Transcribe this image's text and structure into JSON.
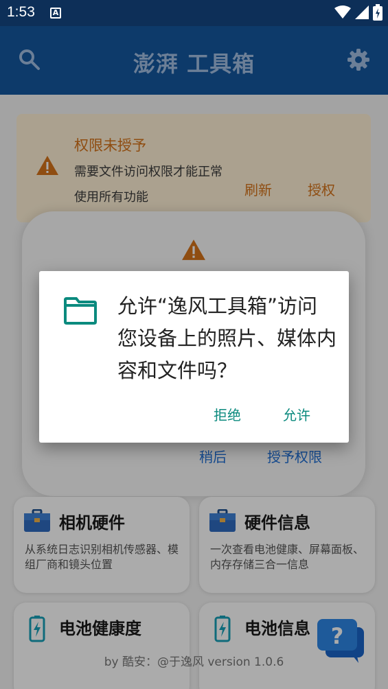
{
  "status_bar": {
    "time": "1:53",
    "notification_letter": "A"
  },
  "app_bar": {
    "title": "澎湃 工具箱"
  },
  "permission_card": {
    "title": "权限未授予",
    "message": "需要文件访问权限才能正常使用所有功能",
    "refresh_label": "刷新",
    "grant_label": "授权"
  },
  "sheet": {
    "later_label": "稍后",
    "grant_permission_label": "授予权限"
  },
  "tools": [
    {
      "title": "相机硬件",
      "description": "从系统日志识别相机传感器、模组厂商和镜头位置"
    },
    {
      "title": "硬件信息",
      "description": "一次查看电池健康、屏幕面板、内存存储三合一信息"
    },
    {
      "title": "电池健康度",
      "description": ""
    },
    {
      "title": "电池信息",
      "description": ""
    }
  ],
  "footer": {
    "text": "by 酷安：@于逸风 version 1.0.6"
  },
  "dialog": {
    "message": "允许“逸风工具箱”访问您设备上的照片、媒体内容和文件吗？",
    "deny_label": "拒绝",
    "allow_label": "允许"
  },
  "colors": {
    "app_bar": "#0d3a6a",
    "warning": "#d5731a",
    "dialog_accent": "#0b8a7e",
    "link_blue": "#1f6fd6"
  },
  "icons": [
    "search-icon",
    "gear-icon",
    "warning-icon",
    "briefcase-icon",
    "battery-icon",
    "help-icon",
    "folder-icon",
    "wifi-icon",
    "signal-icon",
    "battery-status-icon"
  ]
}
